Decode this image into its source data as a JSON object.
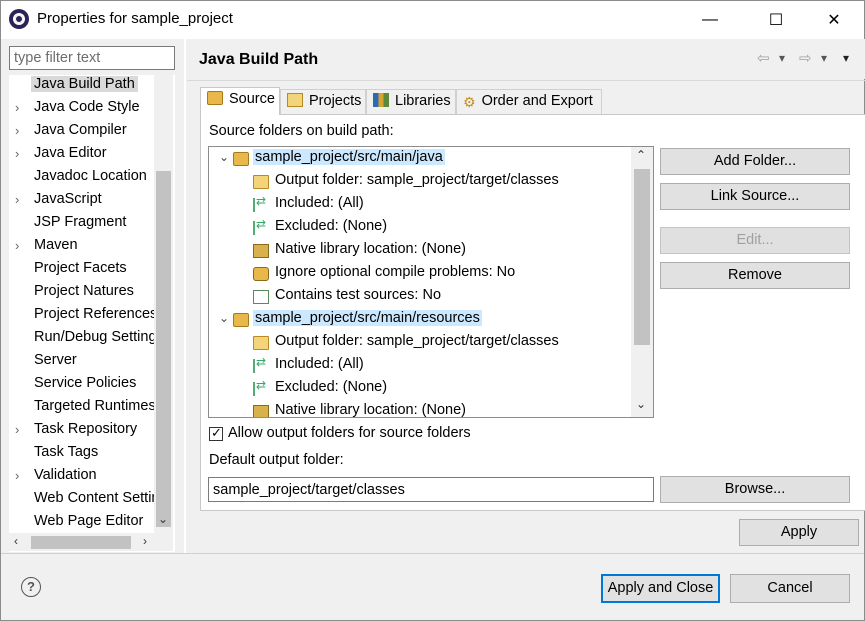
{
  "window": {
    "title": "Properties for sample_project",
    "minimize_glyph": "—",
    "maximize_glyph": "☐",
    "close_glyph": "✕"
  },
  "filter": {
    "placeholder": "type filter text",
    "value": ""
  },
  "left_tree": {
    "items": [
      {
        "label": "Java Build Path",
        "expandable": false,
        "selected": true
      },
      {
        "label": "Java Code Style",
        "expandable": true
      },
      {
        "label": "Java Compiler",
        "expandable": true
      },
      {
        "label": "Java Editor",
        "expandable": true
      },
      {
        "label": "Javadoc Location",
        "expandable": false
      },
      {
        "label": "JavaScript",
        "expandable": true
      },
      {
        "label": "JSP Fragment",
        "expandable": false
      },
      {
        "label": "Maven",
        "expandable": true
      },
      {
        "label": "Project Facets",
        "expandable": false
      },
      {
        "label": "Project Natures",
        "expandable": false
      },
      {
        "label": "Project References",
        "expandable": false
      },
      {
        "label": "Run/Debug Settings",
        "expandable": false
      },
      {
        "label": "Server",
        "expandable": false
      },
      {
        "label": "Service Policies",
        "expandable": false
      },
      {
        "label": "Targeted Runtimes",
        "expandable": false
      },
      {
        "label": "Task Repository",
        "expandable": true
      },
      {
        "label": "Task Tags",
        "expandable": false
      },
      {
        "label": "Validation",
        "expandable": true
      },
      {
        "label": "Web Content Settings",
        "expandable": false
      },
      {
        "label": "Web Page Editor",
        "expandable": false
      }
    ],
    "expand_glyph": "›",
    "scroll_down": "⌄",
    "scroll_left": "‹",
    "scroll_right": "›"
  },
  "page": {
    "title": "Java Build Path",
    "nav": {
      "back": "⇦",
      "back_menu": "▾",
      "forward": "⇨",
      "forward_menu": "▾",
      "view_menu": "▾"
    }
  },
  "tabs": [
    {
      "label": "Source",
      "icon": "source-folder-icon",
      "active": true
    },
    {
      "label": "Projects",
      "icon": "project-folder-icon"
    },
    {
      "label": "Libraries",
      "icon": "libraries-icon"
    },
    {
      "label": "Order and Export",
      "icon": "order-export-icon"
    }
  ],
  "source": {
    "label": "Source folders on build path:",
    "folders": [
      {
        "name": "sample_project/src/main/java",
        "children": [
          {
            "text": "Output folder: sample_project/target/classes",
            "icon": "output-folder-icon"
          },
          {
            "text": "Included: (All)",
            "icon": "included-filter-icon"
          },
          {
            "text": "Excluded: (None)",
            "icon": "excluded-filter-icon"
          },
          {
            "text": "Native library location: (None)",
            "icon": "native-library-icon"
          },
          {
            "text": "Ignore optional compile problems: No",
            "icon": "ignore-problems-icon"
          },
          {
            "text": "Contains test sources: No",
            "icon": "test-sources-icon"
          }
        ]
      },
      {
        "name": "sample_project/src/main/resources",
        "children": [
          {
            "text": "Output folder: sample_project/target/classes",
            "icon": "output-folder-icon"
          },
          {
            "text": "Included: (All)",
            "icon": "included-filter-icon"
          },
          {
            "text": "Excluded: (None)",
            "icon": "excluded-filter-icon"
          },
          {
            "text": "Native library location: (None)",
            "icon": "native-library-icon"
          }
        ]
      }
    ],
    "expanded_glyph": "⌄",
    "scroll_up": "⌃",
    "scroll_down": "⌄"
  },
  "side_buttons": {
    "add_folder": "Add Folder...",
    "link_source": "Link Source...",
    "edit": "Edit...",
    "remove": "Remove"
  },
  "allow_output_folders": {
    "label": "Allow output folders for source folders",
    "checked": true
  },
  "default_output": {
    "label": "Default output folder:",
    "value": "sample_project/target/classes",
    "browse": "Browse..."
  },
  "apply": "Apply",
  "footer": {
    "help": "?",
    "apply_close": "Apply and Close",
    "cancel": "Cancel"
  },
  "colors": {
    "selection": "#cce8ff",
    "accent": "#0078d7",
    "disabled_text": "#a0a0a0"
  }
}
